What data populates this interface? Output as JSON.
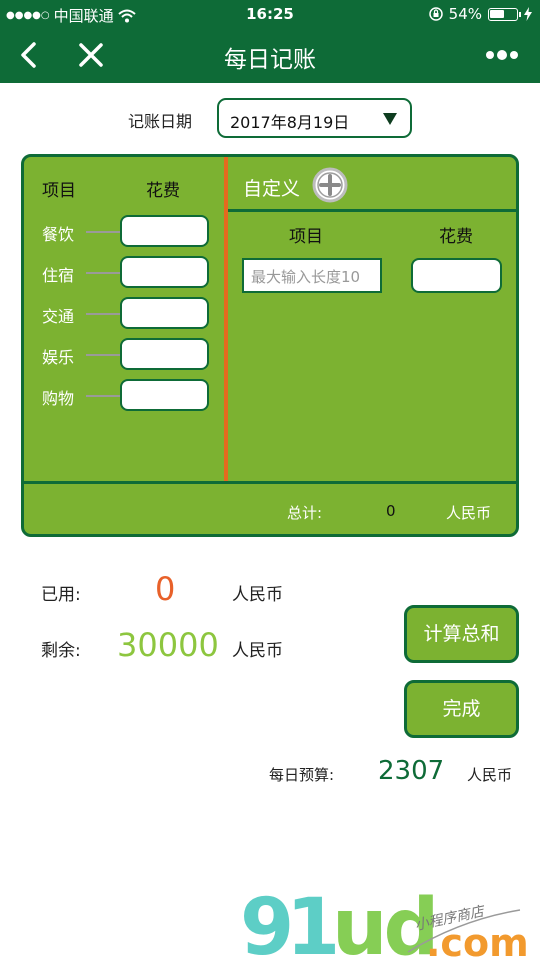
{
  "status_bar": {
    "carrier": "中国联通",
    "time": "16:25",
    "battery_percent": "54%",
    "battery_level": 0.54
  },
  "nav": {
    "title": "每日记账"
  },
  "date": {
    "label": "记账日期",
    "value": "2017年8月19日"
  },
  "preset": {
    "header_item": "项目",
    "header_cost": "花费",
    "rows": [
      {
        "label": "餐饮"
      },
      {
        "label": "住宿"
      },
      {
        "label": "交通"
      },
      {
        "label": "娱乐"
      },
      {
        "label": "购物"
      }
    ]
  },
  "custom": {
    "label": "自定义",
    "header_item": "项目",
    "header_cost": "花费",
    "name_placeholder": "最大输入长度10"
  },
  "total": {
    "label": "总计:",
    "value": "0",
    "unit": "人民币"
  },
  "summary": {
    "used_label": "已用:",
    "used_value": "0",
    "used_unit": "人民币",
    "remain_label": "剩余:",
    "remain_value": "30000",
    "remain_unit": "人民币"
  },
  "buttons": {
    "calc": "计算总和",
    "done": "完成"
  },
  "budget": {
    "label": "每日预算:",
    "value": "2307",
    "unit": "人民币"
  },
  "watermark": {
    "brand": "91ud",
    "tld": ".com",
    "slogan": "小程序商店"
  },
  "colors": {
    "primary": "#0e6b37",
    "panel": "#7cb231",
    "accent": "#e56a1f",
    "used": "#e8612a",
    "remain": "#8dc63f"
  }
}
